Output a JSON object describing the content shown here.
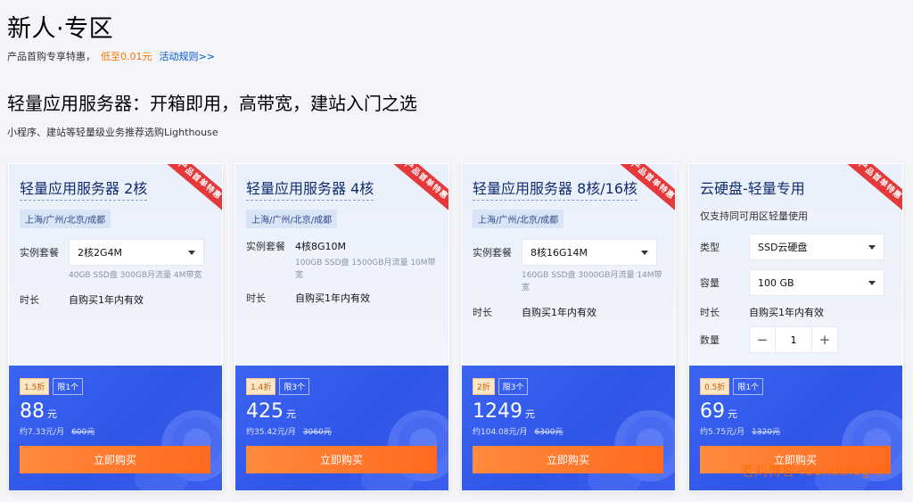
{
  "hero": {
    "title": "新人·专区",
    "sub": "产品首购专享特惠，",
    "sub_highlight": "低至0.01元",
    "rule_link": "活动规则>>"
  },
  "section": {
    "title": "轻量应用服务器：开箱即用，高带宽，建站入门之选",
    "sub": "小程序、建站等轻量级业务推荐选购Lighthouse"
  },
  "ribbon_text": "产品首单特惠",
  "cards": [
    {
      "name": "轻量应用服务器 2核",
      "region": "上海/广州/北京/成都",
      "spec_label": "实例套餐",
      "spec_value": "2核2G4M",
      "spec_note": "40GB SSD盘 300GB月流量 4M带宽",
      "duration_label": "时长",
      "duration_value": "自购买1年内有效",
      "discount": "1.5折",
      "limit": "限1个",
      "price": "88",
      "unit": "元",
      "monthly": "约7.33元/月",
      "original": "600元",
      "buy": "立即购买"
    },
    {
      "name": "轻量应用服务器 4核",
      "region": "上海/广州/北京/成都",
      "spec_label": "实例套餐",
      "spec_value": "4核8G10M",
      "spec_note": "100GB SSD盘 1500GB月流量 10M带宽",
      "duration_label": "时长",
      "duration_value": "自购买1年内有效",
      "discount": "1.4折",
      "limit": "限3个",
      "price": "425",
      "unit": "元",
      "monthly": "约35.42元/月",
      "original": "3060元",
      "buy": "立即购买"
    },
    {
      "name": "轻量应用服务器 8核/16核",
      "region": "上海/广州/北京/成都",
      "spec_label": "实例套餐",
      "spec_value": "8核16G14M",
      "spec_note": "160GB SSD盘 3000GB月流量 14M带宽",
      "duration_label": "时长",
      "duration_value": "自购买1年内有效",
      "discount": "2折",
      "limit": "限3个",
      "price": "1249",
      "unit": "元",
      "monthly": "约104.08元/月",
      "original": "6300元",
      "buy": "立即购买"
    },
    {
      "name": "云硬盘-轻量专用",
      "desc": "仅支持同可用区轻量使用",
      "type_label": "类型",
      "type_value": "SSD云硬盘",
      "capacity_label": "容量",
      "capacity_value": "100 GB",
      "duration_label": "时长",
      "duration_value": "自购买1年内有效",
      "qty_label": "数量",
      "qty_minus": "−",
      "qty_value": "1",
      "qty_plus": "+",
      "discount": "0.5折",
      "limit": "限1个",
      "price": "69",
      "unit": "元",
      "monthly": "约5.75元/月",
      "original": "1320元",
      "buy": "立即购买"
    }
  ],
  "watermark": "老刘博客-laoliublog.cn"
}
